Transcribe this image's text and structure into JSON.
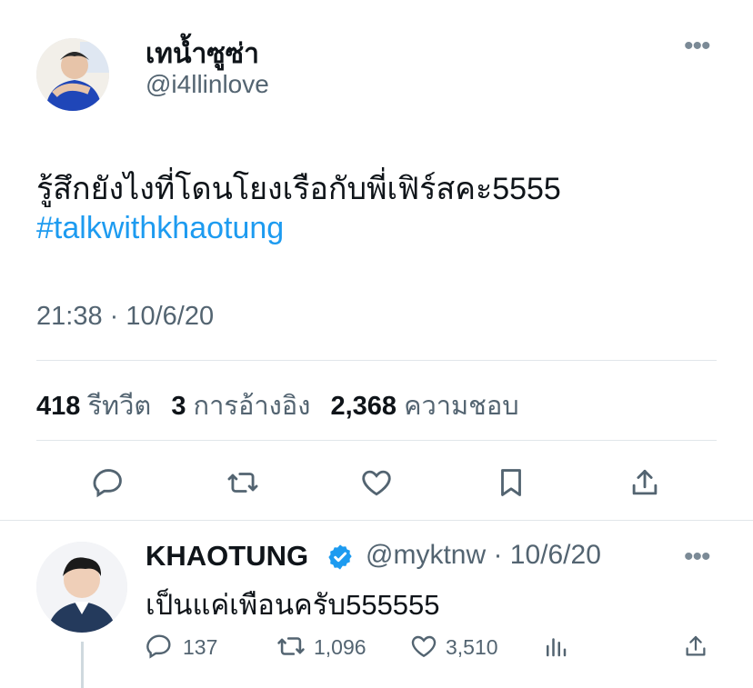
{
  "tweet": {
    "display_name": "เทน้ำซูซ่า",
    "handle": "@i4llinlove",
    "text": "รู้สึกยังไงที่โดนโยงเรือกับพี่เฟิร์สคะ5555",
    "hashtag": "#talkwithkhaotung",
    "timestamp": "21:38 · 10/6/20",
    "stats": {
      "retweets_count": "418",
      "retweets_label": "รีทวีต",
      "quotes_count": "3",
      "quotes_label": "การอ้างอิง",
      "likes_count": "2,368",
      "likes_label": "ความชอบ"
    },
    "more_icon": "more-horizontal-icon"
  },
  "reply": {
    "display_name": "KHAOTUNG",
    "handle_date": "@myktnw · 10/6/20",
    "text": "เป็นแค่เพือนครับ555555",
    "reply_count": "137",
    "retweet_count": "1,096",
    "like_count": "3,510"
  },
  "colors": {
    "accent": "#1d9bf0",
    "text": "#0f1419",
    "muted": "#536471",
    "divider": "#e1e6ea"
  }
}
